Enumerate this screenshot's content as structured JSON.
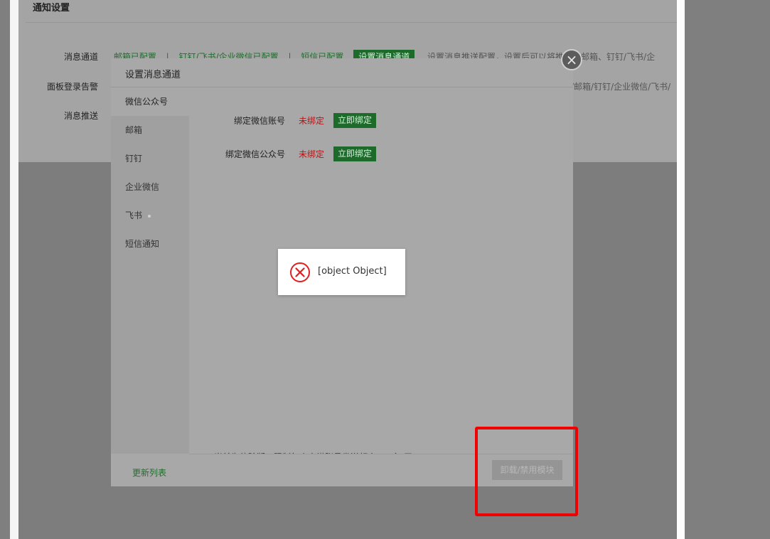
{
  "settings": {
    "title": "通知设置",
    "rows": [
      {
        "label": "消息通道",
        "items": [
          "邮箱已配置",
          "钉钉/飞书/企业微信已配置",
          "短信已配置"
        ],
        "button": "设置消息通道",
        "desc": "设置消息推送配置，设置后可以将推送至邮箱、钉钉/飞书/企"
      },
      {
        "label": "面板登录告警",
        "desc": "/邮箱/钉钉/企业微信/飞书/"
      },
      {
        "label": "消息推送"
      }
    ]
  },
  "modal": {
    "title": "设置消息通道",
    "close_glyph": "×",
    "sidebar": {
      "items": [
        {
          "label": "微信公众号",
          "active": true
        },
        {
          "label": "邮箱"
        },
        {
          "label": "钉钉"
        },
        {
          "label": "企业微信"
        },
        {
          "label": "飞书"
        },
        {
          "label": "短信通知"
        }
      ]
    },
    "bind_rows": [
      {
        "label": "绑定微信账号",
        "status": "未绑定",
        "button": "立即绑定"
      },
      {
        "label": "绑定微信公众号",
        "status": "未绑定",
        "button": "立即绑定"
      }
    ],
    "note": "当前为体验版，限制每个宝塔账号发送频率100条/天",
    "footer": {
      "update_list": "更新列表",
      "uninstall_button": "卸载/禁用模块"
    }
  },
  "toast": {
    "message": "[object Object]",
    "icon": "error-circle-icon"
  },
  "colors": {
    "accent_green": "#20a53a",
    "error_red": "#e02020",
    "highlight_red": "#f00000"
  }
}
